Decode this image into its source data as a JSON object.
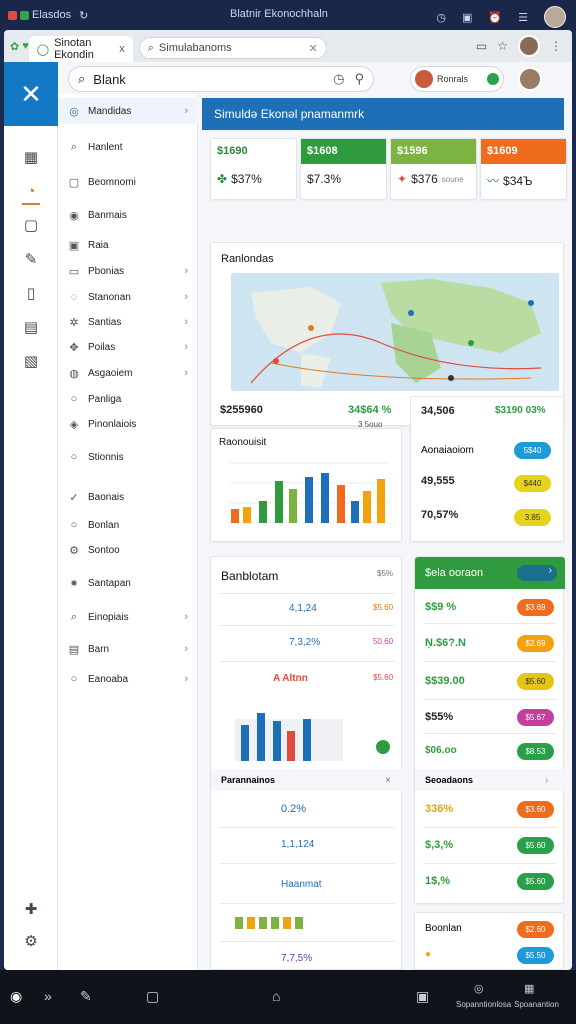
{
  "statusbar": {
    "app_name": "Elasdos",
    "center_text": "Blatnir Ekonochhaln"
  },
  "browser": {
    "tab_label": "Sinotan Ekondin",
    "tab_close": "x",
    "address": "Simulabanoms"
  },
  "search": {
    "value": "Blank"
  },
  "user_pill": {
    "label": "Ronrals"
  },
  "sidebar": {
    "items": [
      {
        "label": "Mandidas"
      },
      {
        "label": "Hanlent"
      },
      {
        "label": "Beomnomi"
      },
      {
        "label": "Banmais"
      },
      {
        "label": "Raia"
      },
      {
        "label": "Pbonias"
      },
      {
        "label": "Stanonan"
      },
      {
        "label": "Santias"
      },
      {
        "label": "Poilas"
      },
      {
        "label": "Asgaoiem"
      },
      {
        "label": "Panliga"
      },
      {
        "label": "Pinonlaiois"
      },
      {
        "label": "Stionnis"
      },
      {
        "label": "Baonais"
      },
      {
        "label": "Bonlan"
      },
      {
        "label": "Sontoo"
      },
      {
        "label": "Santapan"
      },
      {
        "label": "Einopiais"
      },
      {
        "label": "Barn"
      },
      {
        "label": "Eanoaba"
      }
    ]
  },
  "banner": {
    "title": "Simuldə Ekonəl pnamanmrk"
  },
  "stats": [
    {
      "head": "$1690",
      "value": "$37%",
      "color": "#ffffff",
      "text": "#2a8a3a"
    },
    {
      "head": "$1608",
      "value": "$7.3%",
      "color": "#2f9b3e",
      "text": "#ffffff"
    },
    {
      "head": "$1596",
      "value": "$376",
      "sub": "soune",
      "color": "#7cb342",
      "text": "#ffffff"
    },
    {
      "head": "$1609",
      "value": "$34Ъ",
      "color": "#ef6c1f",
      "text": "#ffffff"
    }
  ],
  "map_card": {
    "title": "Ranlondas",
    "k1": "$255960",
    "k2": "34$64 %",
    "k2_sub": "3 5ouo"
  },
  "side_metrics": {
    "top_a": "34,506",
    "top_b": "$3190 03%",
    "title": "Aonaiaoiom",
    "v1": "49,555",
    "v2": "70,57%",
    "pills": [
      "5$40",
      "$440",
      "3.85"
    ]
  },
  "bar_card": {
    "title": "Raonouisit"
  },
  "list_card": {
    "title": "Banblotam",
    "badge": "$5%",
    "rows": [
      {
        "value": "4,1,24",
        "right": "$5.60"
      },
      {
        "value": "7,3,2%",
        "right": "50.60"
      },
      {
        "value": "A Altnn",
        "right": "$5.60"
      }
    ],
    "section": "Parannainos",
    "rows2": [
      {
        "value": "0.2%",
        "right": ""
      },
      {
        "value": "1,1,124",
        "right": ""
      },
      {
        "value": "Haanmat",
        "right": ""
      },
      {
        "value": "",
        "right": ""
      },
      {
        "value": "7,7,5%",
        "right": ""
      }
    ]
  },
  "green_card": {
    "title": "$ela ooraon",
    "rows": [
      {
        "value": "$$9 %",
        "pill": "$3.69",
        "pcolor": "#ef6c1f"
      },
      {
        "value": "Ņ.$6?.N",
        "pill": "$2.69",
        "pcolor": "#f2a20f"
      },
      {
        "value": "$$39.00",
        "pill": "$5.60",
        "pcolor": "#e6c416"
      },
      {
        "value": "$55%",
        "pill": "$5.67",
        "pcolor": "#c23fa0"
      },
      {
        "value": "$06.oo",
        "pill": "$8.53",
        "pcolor": "#27a048"
      }
    ],
    "section": "Seoadaons",
    "rows2": [
      {
        "value": "336%",
        "pill": "$3.60",
        "pcolor": "#ef6c1f"
      },
      {
        "value": "$,3,%",
        "pill": "$5.60",
        "pcolor": "#27a048"
      },
      {
        "value": "1$,%",
        "pill": "$5.60",
        "pcolor": "#27a048"
      }
    ]
  },
  "bottom_card": {
    "title": "Boonlan",
    "pills": [
      "$2.60",
      "$5.50"
    ]
  },
  "taskbar": {
    "label1": "Sopanntionlosa",
    "label2": "Spoanantion"
  }
}
